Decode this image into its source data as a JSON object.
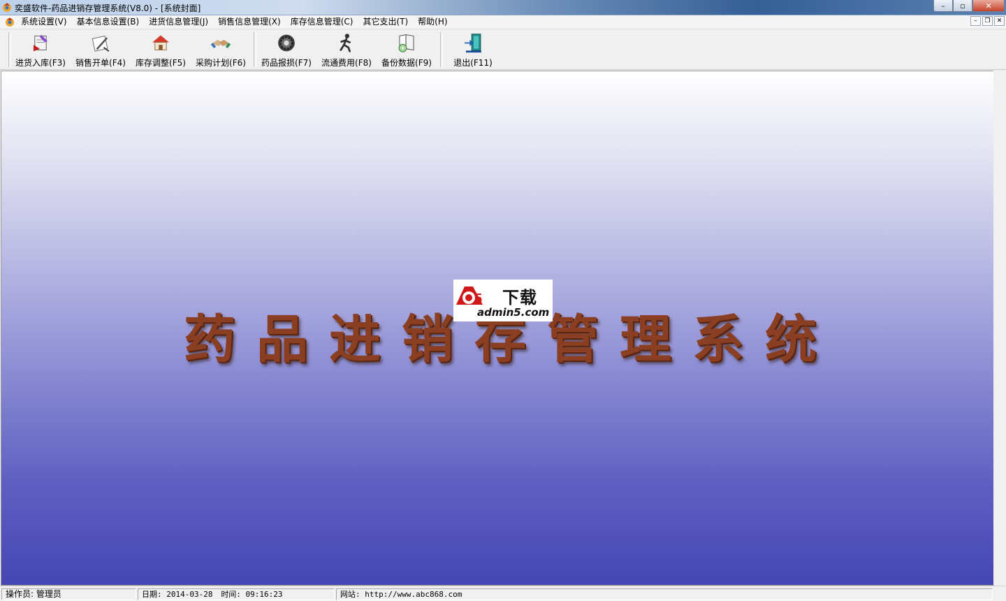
{
  "window": {
    "title": "奕盛软件-药品进销存管理系统(V8.0) - [系统封面]",
    "caption_buttons": {
      "minimize": "–",
      "maximize": "▫",
      "close": "✕"
    }
  },
  "menubar": {
    "items": [
      "系统设置(V)",
      "基本信息设置(B)",
      "进货信息管理(J)",
      "销售信息管理(X)",
      "库存信息管理(C)",
      "其它支出(T)",
      "帮助(H)"
    ],
    "mdi_buttons": {
      "minimize": "–",
      "restore": "❐",
      "close": "✕"
    }
  },
  "toolbar": {
    "buttons": [
      {
        "label": "进货入库(F3)",
        "icon": "purchase-stock-icon"
      },
      {
        "label": "销售开单(F4)",
        "icon": "sales-order-icon"
      },
      {
        "label": "库存调整(F5)",
        "icon": "house-icon"
      },
      {
        "label": "采购计划(F6)",
        "icon": "handshake-icon"
      },
      {
        "label": "药品报损(F7)",
        "icon": "gear-icon"
      },
      {
        "label": "流通费用(F8)",
        "icon": "runner-icon"
      },
      {
        "label": "备份数据(F9)",
        "icon": "book-disc-icon"
      },
      {
        "label": "退出(F11)",
        "icon": "exit-door-icon"
      }
    ]
  },
  "main": {
    "splash_title": "药品进销存管理系统",
    "watermark": {
      "title": "下载",
      "site": "admin5.com"
    },
    "colors": {
      "splash_text": "#8a3f22",
      "gradient_top": "#ffffff",
      "gradient_bottom": "#4646b4"
    }
  },
  "statusbar": {
    "operator": "操作员: 管理员",
    "date": "日期: 2014-03-28",
    "time": "时间: 09:16:23",
    "website": "网站: http://www.abc868.com"
  }
}
